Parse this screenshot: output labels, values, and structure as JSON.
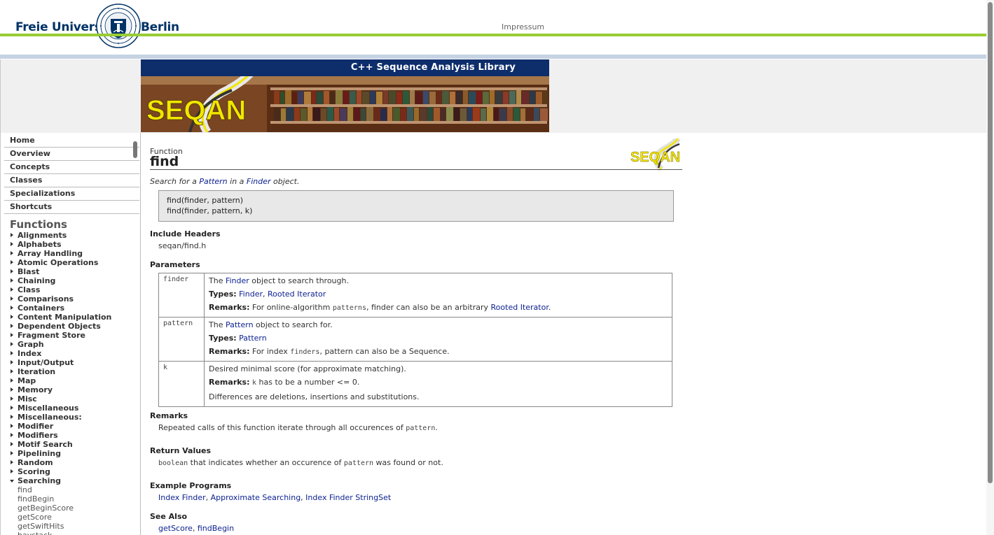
{
  "header": {
    "logo_left": "Freie Universität",
    "logo_right": "Berlin",
    "impressum": "Impressum"
  },
  "banner": {
    "title": "C++ Sequence Analysis Library",
    "logo_text": "SEQAN"
  },
  "sidebar": {
    "nav": [
      "Home",
      "Overview",
      "Concepts",
      "Classes",
      "Specializations",
      "Shortcuts"
    ],
    "functions_heading": "Functions",
    "categories": [
      "Alignments",
      "Alphabets",
      "Array Handling",
      "Atomic Operations",
      "Blast",
      "Chaining",
      "Class",
      "Comparisons",
      "Containers",
      "Content Manipulation",
      "Dependent Objects",
      "Fragment Store",
      "Graph",
      "Index",
      "Input/Output",
      "Iteration",
      "Map",
      "Memory",
      "Misc",
      "Miscellaneous",
      "Miscellaneous:",
      "Modifier",
      "Modifiers",
      "Motif Search",
      "Pipelining",
      "Random",
      "Scoring"
    ],
    "open_category": "Searching",
    "open_items": [
      "find",
      "findBegin",
      "getBeginScore",
      "getScore",
      "getSwiftHits",
      "haystack"
    ]
  },
  "page": {
    "kind": "Function",
    "name": "find",
    "summary": {
      "pre": "Search for a ",
      "link1": "Pattern",
      "mid": " in a ",
      "link2": "Finder",
      "post": " object."
    },
    "signatures": [
      "find(finder, pattern)",
      "find(finder, pattern, k)"
    ],
    "include_headers_title": "Include Headers",
    "include_header": "seqan/find.h",
    "parameters_title": "Parameters",
    "parameters": {
      "finder": {
        "name": "finder",
        "desc_pre": "The ",
        "desc_link": "Finder",
        "desc_post": " object to search through.",
        "types_label": "Types:",
        "types_link1": "Finder",
        "types_sep": ", ",
        "types_link2": "Rooted Iterator",
        "remarks_label": "Remarks:",
        "remarks_pre": "For online-algorithm ",
        "remarks_code": "patterns",
        "remarks_mid": ", finder can also be an arbitrary ",
        "remarks_link": "Rooted Iterator",
        "remarks_post": "."
      },
      "pattern": {
        "name": "pattern",
        "desc_pre": "The ",
        "desc_link": "Pattern",
        "desc_post": " object to search for.",
        "types_label": "Types:",
        "types_link": "Pattern",
        "remarks_label": "Remarks:",
        "remarks_pre": "For index ",
        "remarks_code": "finders",
        "remarks_post": ", pattern can also be a Sequence."
      },
      "k": {
        "name": "k",
        "desc": "Desired minimal score (for approximate matching).",
        "remarks_label": "Remarks:",
        "remarks_code": "k",
        "remarks_post": " has to be a number <= 0.",
        "extra": "Differences are deletions, insertions and substitutions."
      }
    },
    "remarks_title": "Remarks",
    "remarks_pre": "Repeated calls of this function iterate through all occurences of ",
    "remarks_code": "pattern",
    "remarks_post": ".",
    "return_title": "Return Values",
    "return_code1": "boolean",
    "return_mid": " that indicates whether an occurence of ",
    "return_code2": "pattern",
    "return_post": " was found or not.",
    "examples_title": "Example Programs",
    "examples": [
      "Index Finder",
      "Approximate Searching",
      "Index Finder StringSet"
    ],
    "see_also_title": "See Also",
    "see_also": [
      "getScore",
      "findBegin"
    ]
  },
  "colors": {
    "fu_blue": "#003366",
    "fu_green": "#99cc33",
    "banner_blue": "#0d2d6b",
    "link": "#0a1f8f",
    "seqan_yellow": "#f2e600"
  }
}
